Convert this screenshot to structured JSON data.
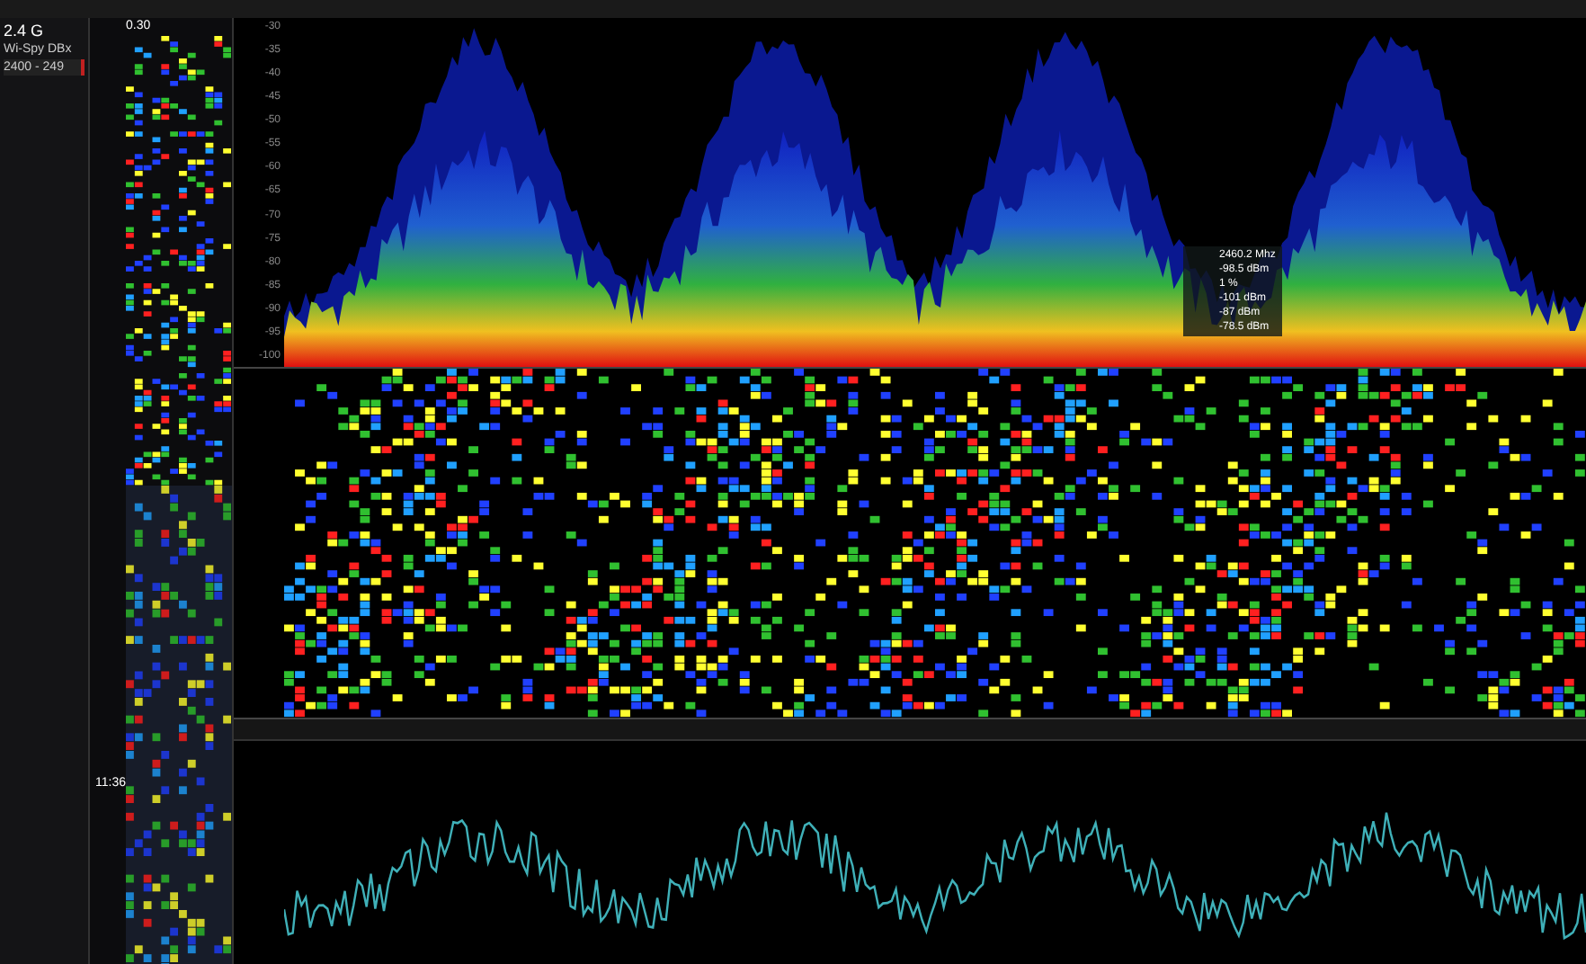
{
  "device": {
    "band": "2.4 G",
    "model": "Wi-Spy DBx",
    "range": "2400 - 249"
  },
  "strip": {
    "rate": "0.30",
    "time": "11:36"
  },
  "spectrum": {
    "y_labels": [
      "-30",
      "-35",
      "-40",
      "-45",
      "-50",
      "-55",
      "-60",
      "-65",
      "-70",
      "-75",
      "-80",
      "-85",
      "-90",
      "-95",
      "-100"
    ]
  },
  "tooltip": {
    "values": [
      "2460.2 Mhz",
      "-98.5 dBm",
      "1 %",
      "-101 dBm",
      "-87 dBm",
      "-78.5 dBm"
    ]
  }
}
